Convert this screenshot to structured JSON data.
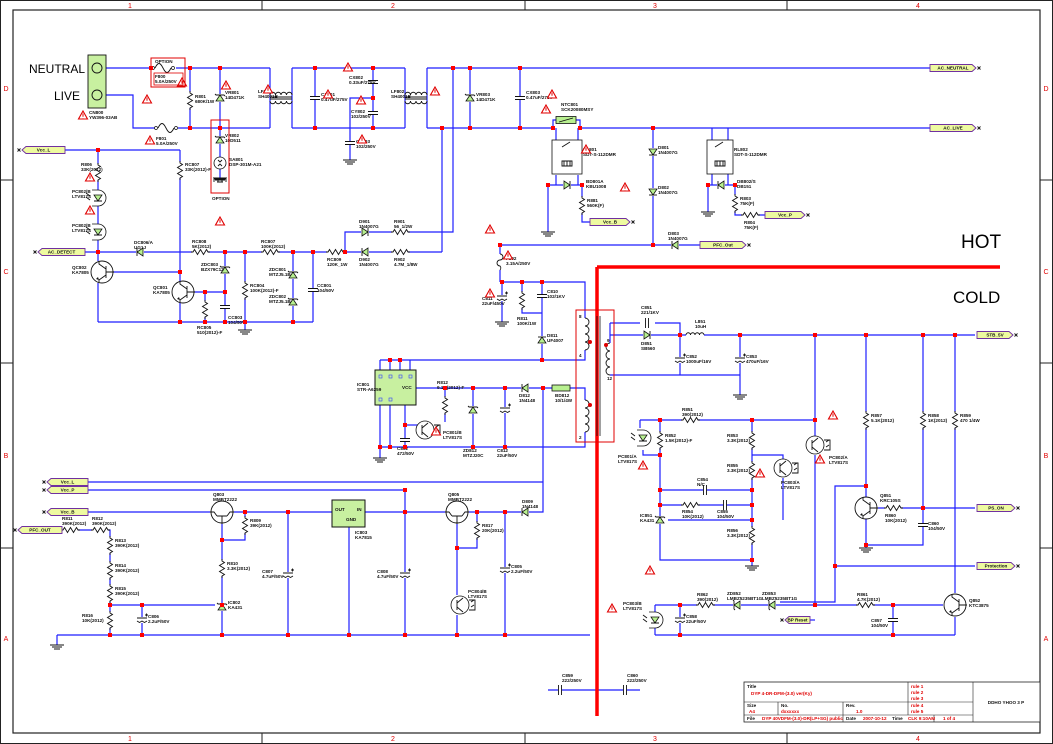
{
  "colors": {
    "wire": "#1f1fff",
    "junction": "#ff0000",
    "net_label_fill": "#eefaa0",
    "net_label_stroke": "#7030a0",
    "ic_fill": "#c8f0a0",
    "divider": "#ff0000"
  },
  "frame": {
    "columns": [
      "1",
      "2",
      "3",
      "4"
    ],
    "rows": [
      "D",
      "C",
      "B",
      "A"
    ]
  },
  "mains": {
    "neutral": "NEUTRAL",
    "live": "LIVE",
    "option": "OPTION",
    "option2": "OPTION"
  },
  "zones": {
    "hot": "HOT",
    "cold": "COLD"
  },
  "transformer_pins": {
    "p8": "8",
    "p4": "4",
    "p2": "2",
    "p9": "9",
    "p12": "12"
  },
  "nets": {
    "ac_neutral": "AC_NEUTRAL",
    "ac_live": "AC_LIVE",
    "vcc_l_top": "Vcc_L",
    "ac_detect": "AC_DETECT",
    "vcc_b_top": "Vcc_B",
    "vcc_p_top": "Vcc_P",
    "pfc_out_top": "PFC_Out",
    "stb_5v": "STB_5V",
    "ps_on": "PS_ON",
    "protection": "Protection",
    "bp_reset": "BP Reset",
    "vcc_l_bot": "Vcc_L",
    "vcc_p_bot": "Vcc_P",
    "vcc_b_bot": "Vcc_B",
    "pfc_out_bot": "PFC_OUT"
  },
  "components": {
    "CN800": [
      "CN800",
      "YW396-03AB"
    ],
    "F800": [
      "F800",
      "5.0A/250V"
    ],
    "F801": [
      "F801",
      "5.0A/250V"
    ],
    "R801": [
      "R801",
      "680K/1W"
    ],
    "VR801": [
      "VR801",
      "14D471K"
    ],
    "VR802": [
      "VR802",
      "10D511"
    ],
    "SA801": [
      "SA801",
      "DSP-301M-A21"
    ],
    "LF801": [
      "LF801",
      "SH4001B"
    ],
    "CX801": [
      "CX801",
      "0.47uF/275V"
    ],
    "CX802": [
      "CX802",
      "0.33uF/275V"
    ],
    "CY802": [
      "CY802",
      "102/250V"
    ],
    "CY803": [
      "CY803",
      "102/250V"
    ],
    "LF802": [
      "LF802",
      "SH4001B"
    ],
    "VR803": [
      "VR803",
      "14D471K"
    ],
    "CX803": [
      "CX803",
      "0.47uF/275V"
    ],
    "NTC801": [
      "NTC801",
      "SCK20080MSY"
    ],
    "RL801": [
      "RL801",
      "SDT-S-112DMR"
    ],
    "BD801A": [
      "BD801A",
      "KBU1008"
    ],
    "R801b": [
      "R881",
      "560K(F)"
    ],
    "D801": [
      "D801",
      "1N4007G"
    ],
    "D802": [
      "D802",
      "1N4007G"
    ],
    "D803": [
      "D803",
      "1N4007G"
    ],
    "RL802": [
      "RL802",
      "SDT-S-112DMR"
    ],
    "BD802": [
      "DB802/S",
      "DB151"
    ],
    "R803": [
      "R803",
      "75K(F)"
    ],
    "R804": [
      "R804",
      "75K(F)"
    ],
    "R806": [
      "R806",
      "33K(2012)"
    ],
    "PC801A": [
      "PC802/B",
      "LTV817S"
    ],
    "PC801B": [
      "PC802/B",
      "LTV817S"
    ],
    "Q802": [
      "QC802",
      "KA7805"
    ],
    "R807": [
      "RC807",
      "33K(2012)-F"
    ],
    "Q801": [
      "QC801",
      "KA7805"
    ],
    "D806": [
      "DC806/A",
      "UG1J"
    ],
    "R808": [
      "RC808",
      "5K(2012)"
    ],
    "ZD803": [
      "ZDC803",
      "BZX79C12"
    ],
    "C803": [
      "CC803",
      "104/50V"
    ],
    "R805": [
      "RC805",
      "510(2012)-F"
    ],
    "R804b": [
      "RC804",
      "100K(2012)-F"
    ],
    "R807b": [
      "RC807",
      "100K(2012)"
    ],
    "ZD801": [
      "ZDC801",
      "MTZJ5.1B"
    ],
    "ZD802": [
      "ZDC802",
      "MTZJ5.1B"
    ],
    "C801": [
      "CC801",
      "104/50V"
    ],
    "R809": [
      "RC809",
      "120K_1W"
    ],
    "D901": [
      "D901",
      "1N4007G"
    ],
    "R901": [
      "R901",
      "56_1/2W"
    ],
    "D902": [
      "D902",
      "1N4007G"
    ],
    "R902": [
      "R902",
      "4.7M_1/8W"
    ],
    "F802": [
      "F802",
      "3.15A/250V"
    ],
    "C811": [
      "C811",
      "22uF/450V"
    ],
    "R811": [
      "R811",
      "100K/1W"
    ],
    "C810": [
      "C810",
      "102/1KV"
    ],
    "D811": [
      "D811",
      "UF4007"
    ],
    "IC801": [
      "IC801",
      "STR-A6259"
    ],
    "R812": [
      "R812",
      "9.1K(2012)-F"
    ],
    "ZD812": [
      "ZD812",
      "MTZJ20C"
    ],
    "C812": [
      "C812",
      "22uF/50V"
    ],
    "D812": [
      "D812",
      "1N4148"
    ],
    "BD812": [
      "BD812",
      "10/1/4W"
    ],
    "PC801C": [
      "PC801/B",
      "LTV817S"
    ],
    "C802": [
      "C802",
      "472/50V"
    ],
    "C851": [
      "C851",
      "221/1KV"
    ],
    "D851": [
      "D851",
      "SB560"
    ],
    "L851": [
      "L851",
      "10uH"
    ],
    "C852": [
      "C852",
      "1000uF/16V"
    ],
    "C853": [
      "C853",
      "470uF/16V"
    ],
    "R851": [
      "R851",
      "390(2012)"
    ],
    "PC851A": [
      "PC801/A",
      "LTV817S"
    ],
    "R852": [
      "R852",
      "1.5K(2012)-F"
    ],
    "R853": [
      "R853",
      "3.3K(2012)"
    ],
    "R855": [
      "R855",
      "3.3K(2012)"
    ],
    "C854": [
      "C854",
      "N/C"
    ],
    "R854": [
      "R854",
      "10K(2012)"
    ],
    "C855": [
      "C855",
      "104/50V"
    ],
    "IC851": [
      "IC851",
      "KA431"
    ],
    "R856": [
      "R856",
      "3.3K(2012)"
    ],
    "PC803": [
      "PC803/A",
      "LTV817S"
    ],
    "PC802": [
      "PC802/A",
      "LTV817S"
    ],
    "R857": [
      "R857",
      "5.1K(2012)"
    ],
    "R858": [
      "R858",
      "1K(2012)"
    ],
    "R859": [
      "R859",
      "470 1/4W"
    ],
    "Q851": [
      "Q851",
      "KRC105S"
    ],
    "R860": [
      "R860",
      "10K(2012)"
    ],
    "C860": [
      "C860",
      "104/50V"
    ],
    "Q852": [
      "Q852",
      "KTC3875"
    ],
    "R861": [
      "R861",
      "4.7K(2012)"
    ],
    "C857": [
      "C857",
      "104/50V"
    ],
    "PC852": [
      "PC803/B",
      "LTV817S"
    ],
    "R862": [
      "R862",
      "390(2012)"
    ],
    "ZD851": [
      "ZD852",
      "LMBZ5235BT1G"
    ],
    "ZD852": [
      "ZD853",
      "LMBZ5235BT1G"
    ],
    "C858": [
      "C858",
      "22uF/50V"
    ],
    "R863": [
      "R811",
      "390K(2012)"
    ],
    "R864": [
      "R812",
      "390K(2012)"
    ],
    "R813": [
      "R813",
      "390K(2012)"
    ],
    "R814": [
      "R814",
      "390K(2012)"
    ],
    "R815": [
      "R815",
      "390K(2012)"
    ],
    "R816": [
      "R816",
      "10K(2012)"
    ],
    "C806": [
      "C806",
      "2.2uF/50V"
    ],
    "Q803": [
      "Q803",
      "MMBT2222"
    ],
    "R809b": [
      "R809",
      "39K(2012)"
    ],
    "R810": [
      "R810",
      "3.3K(2012)"
    ],
    "IC802": [
      "IC802",
      "KA431"
    ],
    "C807": [
      "C807",
      "4.7uF/50V"
    ],
    "IC803": [
      "IC803",
      "KA7815"
    ],
    "C808": [
      "C808",
      "4.7uF/50V"
    ],
    "Q805": [
      "Q805",
      "MMBT2222"
    ],
    "R817": [
      "R817",
      "20K(2012)"
    ],
    "PC804": [
      "PC804/B",
      "LTV817S"
    ],
    "C805": [
      "C805",
      "2.2uF/50V"
    ],
    "D809": [
      "D809",
      "1N4148"
    ],
    "C859": [
      "C859",
      "222/250V"
    ],
    "C860b": [
      "C860",
      "222/250V"
    ]
  },
  "ic_pins": {
    "ic803_out": "OUT",
    "ic803_in": "IN",
    "ic803_gnd": "GND",
    "ic801_vcc": "VCC"
  },
  "title_block": {
    "title_label": "Title",
    "title_value": "DYP 4-DR-DFM-(3.0) ver(Ky)",
    "size_label": "Size",
    "size_value": "A4",
    "no_label": "No.",
    "no_value": "dxxxxxx",
    "rev_label": "Rev.",
    "rev_value": "1.0",
    "file_label": "File",
    "file_value": "DYP 40VDFM-(3.0)-DR(LP+SG) public",
    "date_label": "Date",
    "date_value": "2007-10-12",
    "time_label": "Time",
    "time_value": "CLK 9:10AM",
    "sheet_value": "1 of 4",
    "rules": [
      "rule 1",
      "rule 2",
      "rule 3",
      "rule 4",
      "rule 5"
    ],
    "drawing_no": "DDHO YHOO 3 P"
  }
}
